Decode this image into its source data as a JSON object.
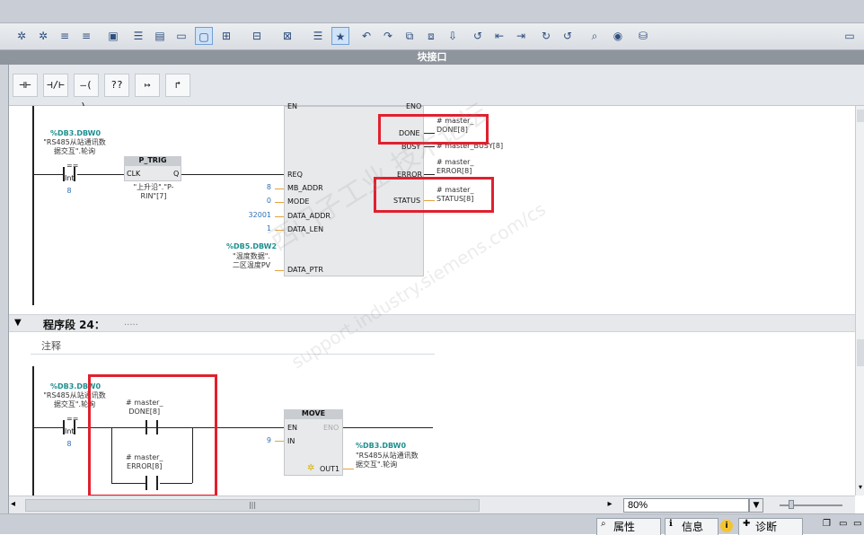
{
  "block_interface_title": "块接口",
  "network24": {
    "label": "程序段 24：",
    "dots": ".....",
    "comment": "注释"
  },
  "network23": {
    "contact_addr": "%DB3.DBW0",
    "contact_name": "\"RS485从站通讯数\n据交互\".轮询",
    "cmp_eq": "==",
    "cmp_type": "Int",
    "cmp_value": "8",
    "ptrig_title": "P_TRIG",
    "ptrig_clk": "CLK",
    "ptrig_q": "Q",
    "ptrig_var": "\"上升沿\".\"P-\nRIN\"[7]",
    "pins": {
      "en": "EN",
      "eno": "ENO",
      "req": "REQ",
      "mb_addr": "MB_ADDR",
      "mode": "MODE",
      "data_addr": "DATA_ADDR",
      "data_len": "DATA_LEN",
      "data_ptr": "DATA_PTR",
      "done": "DONE",
      "busy": "BUSY",
      "error": "ERROR",
      "status": "STATUS"
    },
    "vals": {
      "mb_addr": "8",
      "mode": "0",
      "data_addr": "32001",
      "data_len": "1"
    },
    "data_ptr_addr": "%DB5.DBW2",
    "data_ptr_name": "\"温度数据\".\n二区温度PV",
    "out_done": "# master_\nDONE[8]",
    "out_busy": "# master_BUSY[8]",
    "out_error": "# master_\nERROR[8]",
    "out_status": "# master_\nSTATUS[8]"
  },
  "network24_body": {
    "contact_addr": "%DB3.DBW0",
    "contact_name": "\"RS485从站通讯数\n据交互\".轮询",
    "cmp_eq": "==",
    "cmp_type": "Int",
    "cmp_value": "8",
    "done_var": "# master_\nDONE[8]",
    "error_var": "# master_\nERROR[8]",
    "move_title": "MOVE",
    "move_en": "EN",
    "move_eno": "ENO",
    "move_in": "IN",
    "move_out": "OUT1",
    "move_in_value": "9",
    "out_addr": "%DB3.DBW0",
    "out_name": "\"RS485从站通讯数\n据交互\".轮询"
  },
  "instr_buttons": [
    "⊣⊢",
    "⊣/⊢",
    "–( )–",
    "??",
    "↦",
    "↱"
  ],
  "zoom": {
    "value": "80%",
    "options": [
      "80%"
    ]
  },
  "hscroll_thumb": "|||",
  "bottom_tabs": {
    "properties": "属性",
    "info": "信息",
    "diagnostics": "诊断"
  },
  "watermark": {
    "line1": "西门子工业 技术论坛",
    "line2": "support.industry.siemens.com/cs"
  },
  "colors": {
    "highlight": "#e0202e",
    "address": "#1f8f8f",
    "value": "#2e6fb5",
    "wire_orange": "#e3a33a"
  }
}
